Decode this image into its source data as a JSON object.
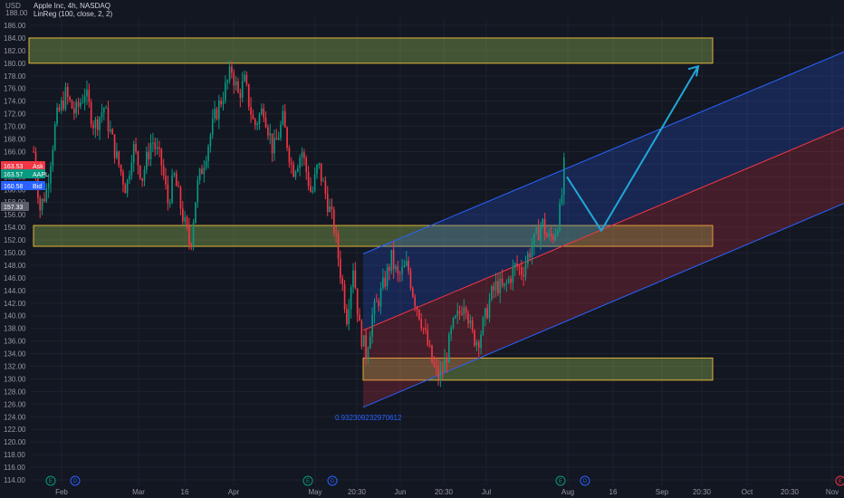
{
  "header": {
    "currency": "USD",
    "top_tick": "188.00",
    "title": "Apple Inc, 4h, NASDAQ",
    "indicator": "LinReg (100, close, 2, 2)"
  },
  "price_tags": [
    {
      "value": "163.53",
      "label": "Ask",
      "color": "#f23645"
    },
    {
      "value": "163.57",
      "label": "AAPL",
      "color": "#089981"
    },
    {
      "value": "160.58",
      "label": "Bid",
      "color": "#2962ff"
    },
    {
      "value": "157.33",
      "label": "",
      "color": "#5d606b"
    }
  ],
  "regression_label": "0.932309232970612",
  "events": [
    {
      "key": "e1",
      "letter": "E",
      "color": "#089981"
    },
    {
      "key": "d1",
      "letter": "D",
      "color": "#2962ff"
    },
    {
      "key": "e2",
      "letter": "E",
      "color": "#089981"
    },
    {
      "key": "d2",
      "letter": "D",
      "color": "#2962ff"
    },
    {
      "key": "e3",
      "letter": "E",
      "color": "#089981"
    },
    {
      "key": "d3",
      "letter": "D",
      "color": "#2962ff"
    },
    {
      "key": "e4",
      "letter": "E",
      "color": "#f23645"
    }
  ],
  "chart_data": {
    "type": "candlestick",
    "title": "Apple Inc, 4h, NASDAQ",
    "symbol": "AAPL",
    "timeframe": "4h",
    "exchange": "NASDAQ",
    "y_unit": "USD",
    "ylim": [
      113.5,
      188
    ],
    "y_ticks": [
      114,
      116,
      118,
      120,
      122,
      124,
      126,
      128,
      130,
      132,
      134,
      136,
      138,
      140,
      142,
      144,
      146,
      148,
      150,
      152,
      154,
      156,
      158,
      160,
      162,
      164,
      166,
      168,
      170,
      172,
      174,
      176,
      178,
      180,
      182,
      184,
      186
    ],
    "x_ticks": [
      "Feb",
      "Mar",
      "16",
      "Apr",
      "May",
      "20:30",
      "Jun",
      "20:30",
      "Jul",
      "Aug",
      "16",
      "Sep",
      "20:30",
      "Oct",
      "20:30",
      "Nov"
    ],
    "grid": true,
    "legend": "top-left",
    "candle_colors": {
      "up": "#089981",
      "down": "#f23645"
    },
    "ohlc_anchors": [
      {
        "t": 0,
        "c": 166
      },
      {
        "t": 2,
        "c": 157
      },
      {
        "t": 4,
        "c": 160
      },
      {
        "t": 7,
        "c": 171
      },
      {
        "t": 10,
        "c": 175
      },
      {
        "t": 13,
        "c": 172
      },
      {
        "t": 16,
        "c": 175.5
      },
      {
        "t": 19,
        "c": 170
      },
      {
        "t": 22,
        "c": 173
      },
      {
        "t": 26,
        "c": 165
      },
      {
        "t": 29,
        "c": 160
      },
      {
        "t": 31,
        "c": 167
      },
      {
        "t": 34,
        "c": 162
      },
      {
        "t": 37,
        "c": 168
      },
      {
        "t": 40,
        "c": 164
      },
      {
        "t": 42,
        "c": 158
      },
      {
        "t": 44,
        "c": 162
      },
      {
        "t": 47,
        "c": 155
      },
      {
        "t": 49,
        "c": 151
      },
      {
        "t": 51,
        "c": 160
      },
      {
        "t": 54,
        "c": 166
      },
      {
        "t": 57,
        "c": 172
      },
      {
        "t": 60,
        "c": 176
      },
      {
        "t": 62,
        "c": 179
      },
      {
        "t": 64,
        "c": 175
      },
      {
        "t": 66,
        "c": 177
      },
      {
        "t": 69,
        "c": 170
      },
      {
        "t": 72,
        "c": 173
      },
      {
        "t": 75,
        "c": 166
      },
      {
        "t": 78,
        "c": 171
      },
      {
        "t": 81,
        "c": 163
      },
      {
        "t": 84,
        "c": 166
      },
      {
        "t": 87,
        "c": 159
      },
      {
        "t": 89,
        "c": 164
      },
      {
        "t": 92,
        "c": 158
      },
      {
        "t": 94,
        "c": 154
      },
      {
        "t": 96,
        "c": 147
      },
      {
        "t": 98,
        "c": 140
      },
      {
        "t": 100,
        "c": 148
      },
      {
        "t": 102,
        "c": 138
      },
      {
        "t": 104,
        "c": 134
      },
      {
        "t": 106,
        "c": 140
      },
      {
        "t": 109,
        "c": 144
      },
      {
        "t": 112,
        "c": 149
      },
      {
        "t": 114,
        "c": 146
      },
      {
        "t": 117,
        "c": 148
      },
      {
        "t": 119,
        "c": 143
      },
      {
        "t": 121,
        "c": 140
      },
      {
        "t": 123,
        "c": 136
      },
      {
        "t": 125,
        "c": 132
      },
      {
        "t": 127,
        "c": 130
      },
      {
        "t": 129,
        "c": 133
      },
      {
        "t": 131,
        "c": 138
      },
      {
        "t": 133,
        "c": 140
      },
      {
        "t": 135,
        "c": 143
      },
      {
        "t": 137,
        "c": 137
      },
      {
        "t": 139,
        "c": 136
      },
      {
        "t": 141,
        "c": 139
      },
      {
        "t": 143,
        "c": 143
      },
      {
        "t": 145,
        "c": 145
      },
      {
        "t": 147,
        "c": 144
      },
      {
        "t": 149,
        "c": 146
      },
      {
        "t": 151,
        "c": 148
      },
      {
        "t": 153,
        "c": 147
      },
      {
        "t": 155,
        "c": 150
      },
      {
        "t": 157,
        "c": 152
      },
      {
        "t": 159,
        "c": 155
      },
      {
        "t": 161,
        "c": 152
      },
      {
        "t": 163,
        "c": 153
      },
      {
        "t": 165,
        "c": 157
      },
      {
        "t": 166,
        "c": 163.5
      }
    ],
    "zones": [
      {
        "name": "resistance",
        "low": 180,
        "high": 184
      },
      {
        "name": "support-mid",
        "low": 151,
        "high": 154.3
      },
      {
        "name": "support-low",
        "low": 129.8,
        "high": 133.3
      }
    ],
    "linreg_channel": {
      "length": 100,
      "source": "close",
      "upper_dev": 2,
      "lower_dev": 2,
      "start": {
        "upper": 149.8,
        "mid": 137.7,
        "lower": 125.5
      },
      "end": {
        "upper": 181.8,
        "mid": 169.8,
        "lower": 157.8
      },
      "pearson_r": 0.932309232970612
    },
    "projection_path": [
      {
        "t": 0,
        "price": 162
      },
      {
        "t": 1,
        "price": 153.5
      },
      {
        "t": 2,
        "price": 179.5
      }
    ]
  }
}
